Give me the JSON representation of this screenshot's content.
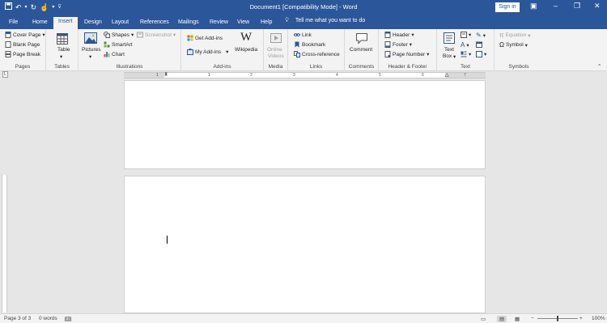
{
  "title_bar": {
    "document_title": "Document1 [Compatibility Mode]  -  Word",
    "sign_in": "Sign in",
    "qat": [
      "save-icon",
      "undo-icon",
      "redo-icon",
      "touch-mode-icon",
      "customize-icon"
    ]
  },
  "tabs": [
    "File",
    "Home",
    "Insert",
    "Design",
    "Layout",
    "References",
    "Mailings",
    "Review",
    "View",
    "Help"
  ],
  "active_tab": "Insert",
  "tell_me": "Tell me what you want to do",
  "ribbon": {
    "pages": {
      "label": "Pages",
      "items": [
        "Cover Page",
        "Blank Page",
        "Page Break"
      ]
    },
    "tables": {
      "label": "Tables",
      "table": "Table"
    },
    "illustrations": {
      "label": "Illustrations",
      "pictures": "Pictures",
      "shapes": "Shapes",
      "smartart": "SmartArt",
      "chart": "Chart",
      "screenshot": "Screenshot"
    },
    "addins": {
      "label": "Add-ins",
      "get": "Get Add-ins",
      "my": "My Add-ins",
      "wikipedia": "Wikipedia"
    },
    "media": {
      "label": "Media",
      "online_videos_1": "Online",
      "online_videos_2": "Videos"
    },
    "links": {
      "label": "Links",
      "link": "Link",
      "bookmark": "Bookmark",
      "cross_reference": "Cross-reference"
    },
    "comments": {
      "label": "Comments",
      "comment": "Comment"
    },
    "header_footer": {
      "label": "Header & Footer",
      "header": "Header",
      "footer": "Footer",
      "page_number": "Page Number"
    },
    "text": {
      "label": "Text",
      "textbox_1": "Text",
      "textbox_2": "Box"
    },
    "symbols": {
      "label": "Symbols",
      "equation": "Equation",
      "symbol": "Symbol"
    }
  },
  "ruler_ticks": [
    "1",
    "1",
    "2",
    "3",
    "4",
    "5",
    "6",
    "7"
  ],
  "status": {
    "page": "Page 3 of 3",
    "words": "0 words",
    "zoom": "100%"
  },
  "colors": {
    "accent": "#2b579a",
    "ribbon": "#f3f3f3",
    "canvas": "#e6e6e6"
  }
}
